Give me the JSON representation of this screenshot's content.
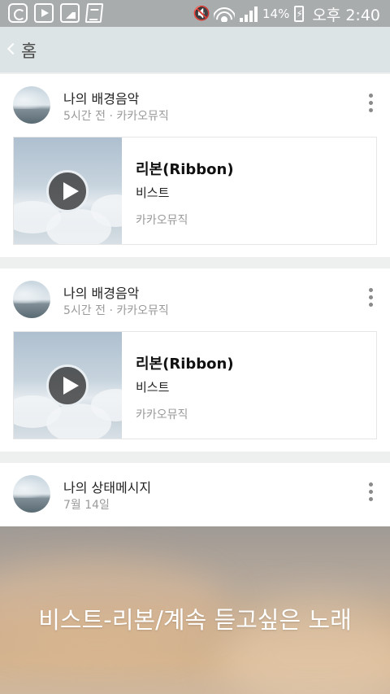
{
  "status_bar": {
    "left_icons": [
      "g-app-icon",
      "play-store-icon",
      "gallery-icon",
      "document-icon"
    ],
    "right_icons": [
      "mute-icon",
      "wifi-icon",
      "signal-icon",
      "battery-charging-icon"
    ],
    "battery": "14%",
    "time": "오후 2:40"
  },
  "app_bar": {
    "back_icon": "chevron-left-icon",
    "title": "홈"
  },
  "feed": [
    {
      "author": "나의 배경음악",
      "meta": "5시간 전 · 카카오뮤직",
      "song": {
        "title": "리본(Ribbon)",
        "artist": "비스트",
        "source": "카카오뮤직"
      }
    },
    {
      "author": "나의 배경음악",
      "meta": "5시간 전 · 카카오뮤직",
      "song": {
        "title": "리본(Ribbon)",
        "artist": "비스트",
        "source": "카카오뮤직"
      }
    },
    {
      "author": "나의 상태메시지",
      "meta": "7월 14일",
      "status_text": "비스트-리본/계속 듣고싶은 노래"
    }
  ]
}
